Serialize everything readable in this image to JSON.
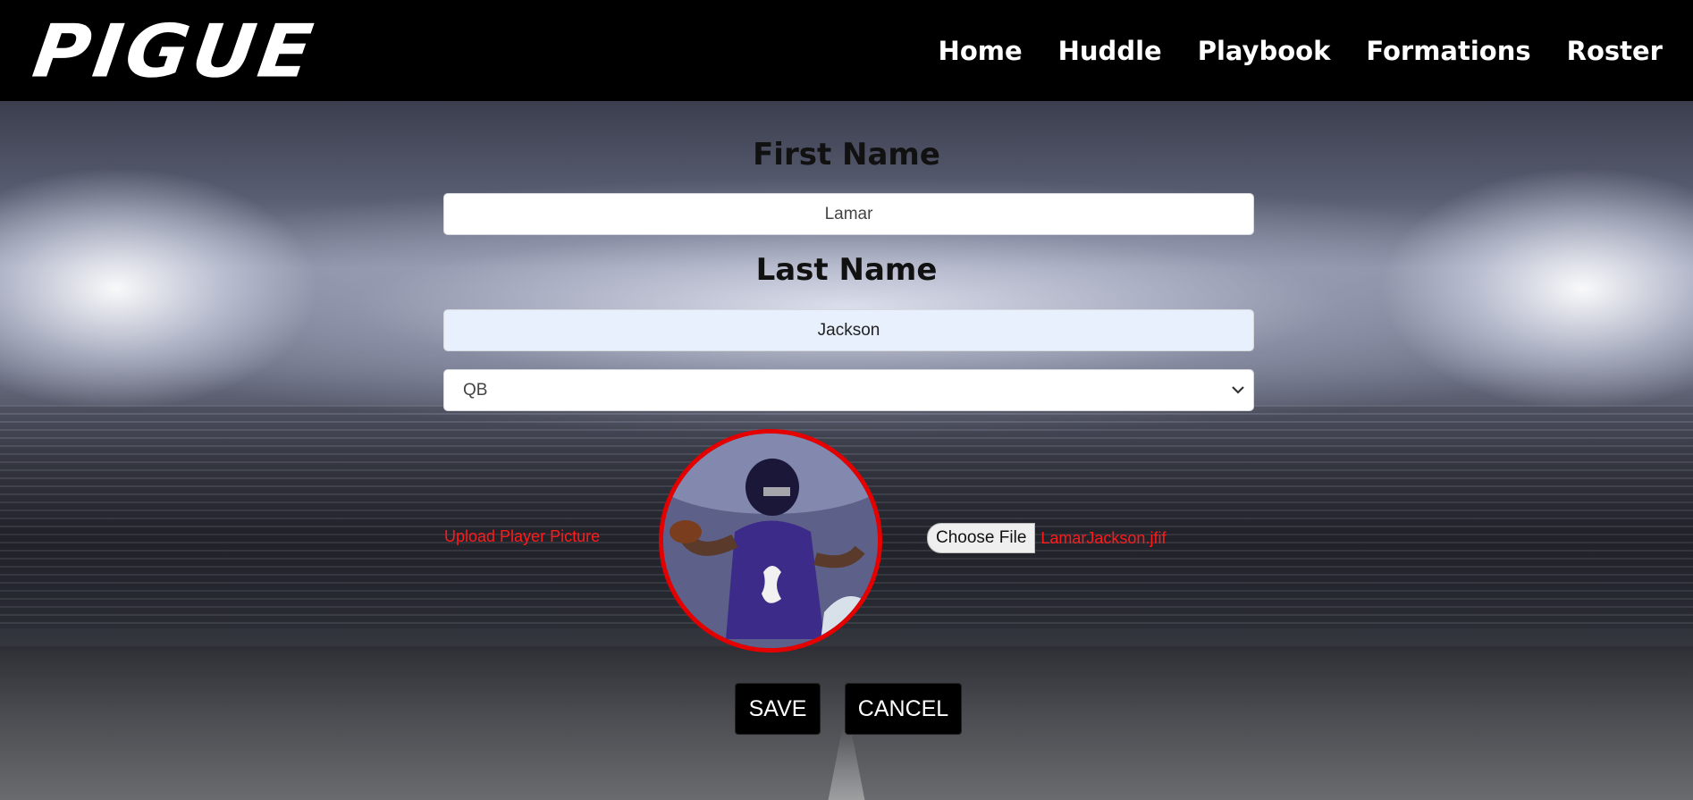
{
  "navbar": {
    "logo_text": "PIGUE",
    "links": [
      "Home",
      "Huddle",
      "Playbook",
      "Formations",
      "Roster"
    ]
  },
  "form": {
    "first_name_label": "First Name",
    "first_name_value": "Lamar",
    "last_name_label": "Last Name",
    "last_name_value": "Jackson",
    "position_value": "QB",
    "upload_label": "Upload Player Picture",
    "choose_file_label": "Choose File",
    "file_name": "LamarJackson.jfif",
    "save_label": "SAVE",
    "cancel_label": "CANCEL"
  },
  "colors": {
    "navbar_bg": "#000000",
    "accent_red": "#e50000",
    "upload_text_red": "#ff1a1a",
    "button_bg": "#000000"
  },
  "icons": {
    "select_chevron": "chevron-down-icon",
    "player_photo": "player-photo"
  }
}
